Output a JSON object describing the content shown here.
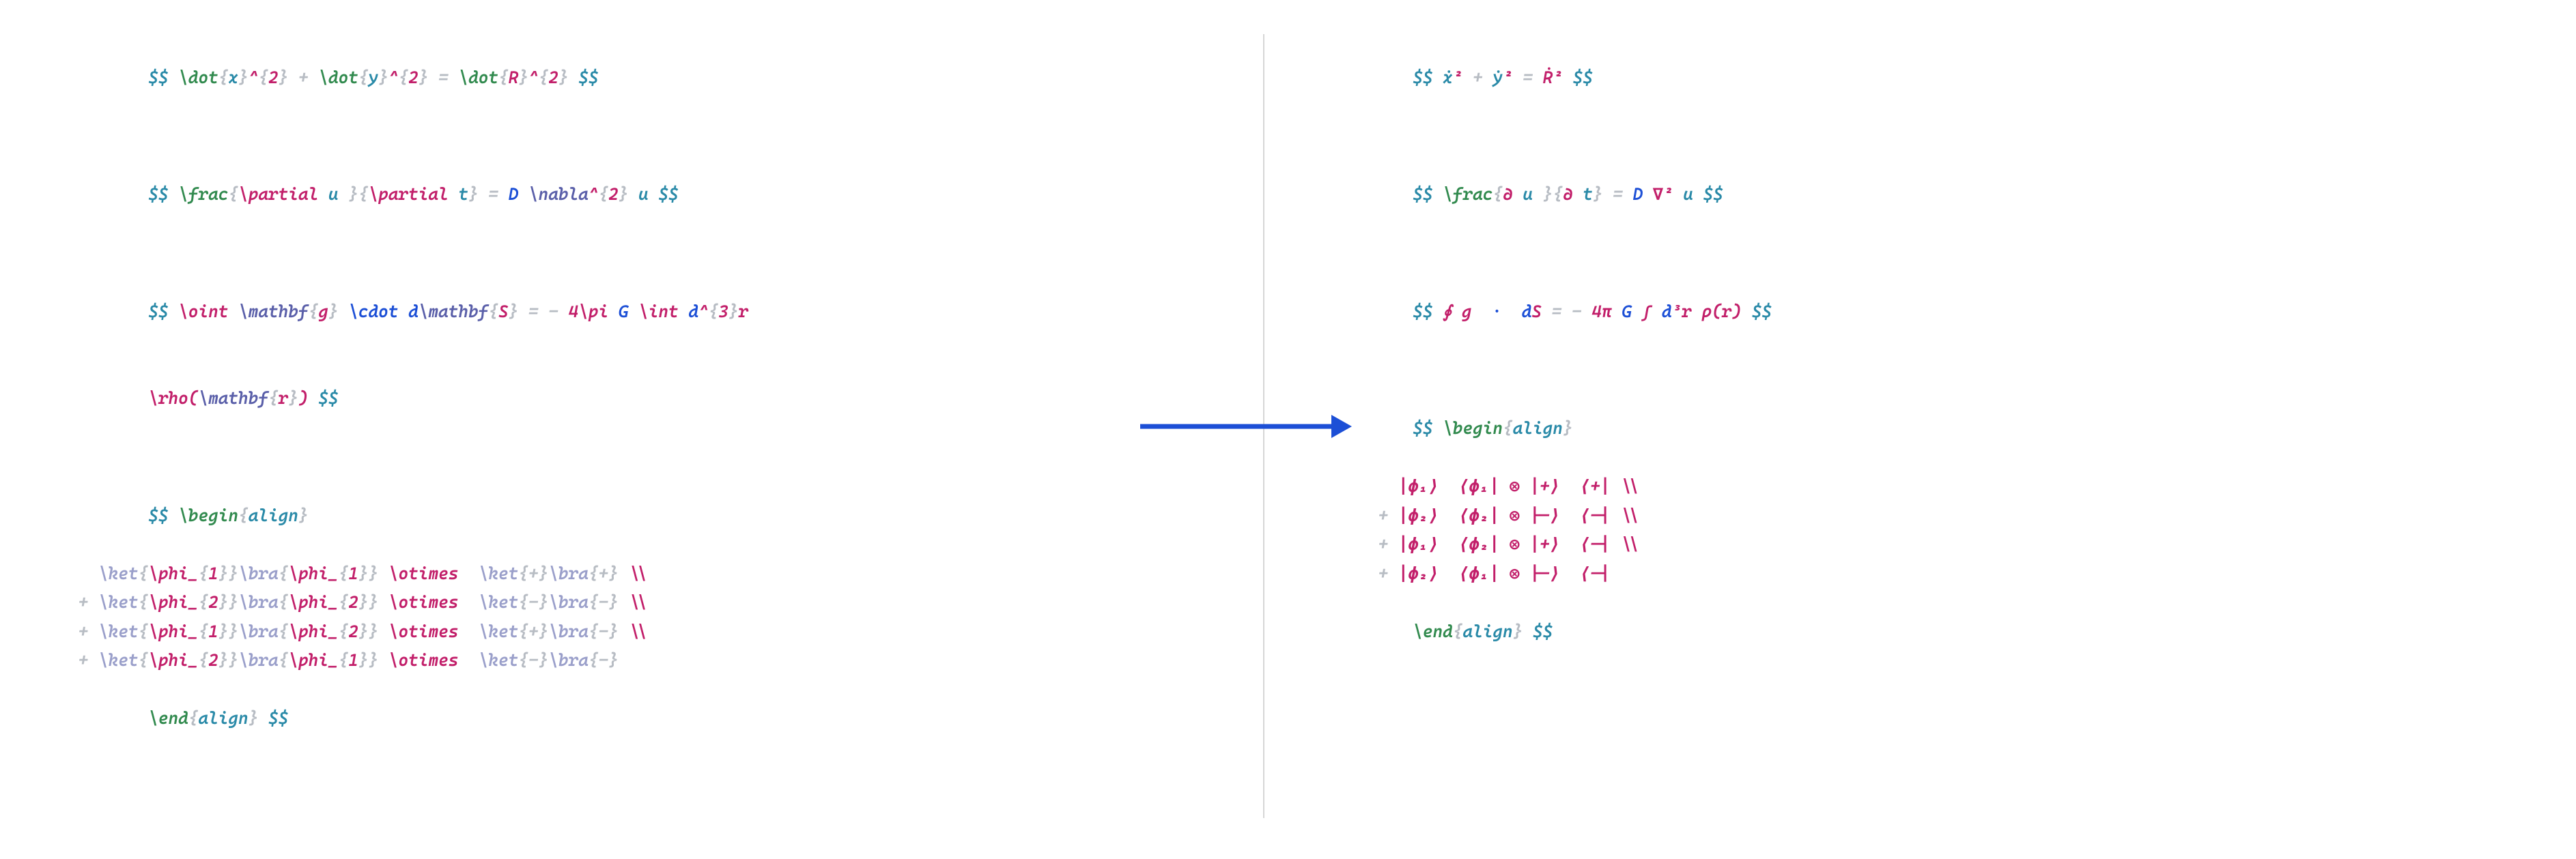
{
  "left": {
    "eq1": {
      "a": "$$ ",
      "b": "\\dot",
      "c": "{",
      "d": "x",
      "e": "}",
      "f": "^",
      "g": "{",
      "h": "2",
      "i": "}",
      "j": " + ",
      "k": "\\dot",
      "l": "{",
      "m": "y",
      "n": "}",
      "o": "^",
      "p": "{",
      "q": "2",
      "r": "}",
      "s": " = ",
      "t": "\\dot",
      "u": "{",
      "v": "R",
      "w": "}",
      "x": "^",
      "y": "{",
      "z": "2",
      "aa": "}",
      "ab": " $$"
    },
    "eq2": {
      "a": "$$ ",
      "b": "\\frac",
      "c": "{",
      "d": "\\partial",
      "e": " u ",
      "f": "}",
      "g": "{",
      "h": "\\partial",
      "i": " t",
      "j": "}",
      "k": " = ",
      "l": "D ",
      "m": "\\nabla",
      "n": "^",
      "o": "{",
      "p": "2",
      "q": "}",
      "r": " u ",
      "s": "$$"
    },
    "eq3l1": {
      "a": "$$ ",
      "b": "\\oint ",
      "c": "\\mathbf",
      "d": "{",
      "e": "g",
      "f": "}",
      "g": " \\cdot",
      "h": " d",
      "i": "\\mathbf",
      "j": "{",
      "k": "S",
      "l": "}",
      "m": " = - ",
      "n": "4",
      "o": "\\pi",
      "p": " G ",
      "q": "\\int ",
      "r": "d",
      "s": "^",
      "t": "{",
      "u": "3",
      "v": "}",
      "w": "r"
    },
    "eq3l2": {
      "a": "\\rho",
      "b": "(",
      "c": "\\mathbf",
      "d": "{",
      "e": "r",
      "f": "}",
      "g": ")",
      "h": " $$"
    },
    "eq4": {
      "open_a": "$$ ",
      "open_b": "\\begin",
      "open_c": "{",
      "open_d": "align",
      "open_e": "}",
      "r1": {
        "pre": "   ",
        "ket": "\\ket",
        "b1": "{",
        "phi": "\\phi",
        "us": "_",
        "b2": "{",
        "n": "1",
        "b3": "}",
        "b4": "}",
        "bra": "\\bra",
        "b5": "{",
        "phi2": "\\phi",
        "us2": "_",
        "b6": "{",
        "n2": "1",
        "b7": "}",
        "b8": "}",
        "ot": " \\otimes ",
        "ket2": " \\ket",
        "b9": "{",
        "sgn": "+",
        "b10": "}",
        "bra2": "\\bra",
        "b11": "{",
        "sgn2": "+",
        "b12": "}",
        "bs": " \\\\"
      },
      "r2": {
        "pre": " + ",
        "ket": "\\ket",
        "b1": "{",
        "phi": "\\phi",
        "us": "_",
        "b2": "{",
        "n": "2",
        "b3": "}",
        "b4": "}",
        "bra": "\\bra",
        "b5": "{",
        "phi2": "\\phi",
        "us2": "_",
        "b6": "{",
        "n2": "2",
        "b7": "}",
        "b8": "}",
        "ot": " \\otimes ",
        "ket2": " \\ket",
        "b9": "{",
        "sgn": "-",
        "b10": "}",
        "bra2": "\\bra",
        "b11": "{",
        "sgn2": "-",
        "b12": "}",
        "bs": " \\\\"
      },
      "r3": {
        "pre": " + ",
        "ket": "\\ket",
        "b1": "{",
        "phi": "\\phi",
        "us": "_",
        "b2": "{",
        "n": "1",
        "b3": "}",
        "b4": "}",
        "bra": "\\bra",
        "b5": "{",
        "phi2": "\\phi",
        "us2": "_",
        "b6": "{",
        "n2": "2",
        "b7": "}",
        "b8": "}",
        "ot": " \\otimes ",
        "ket2": " \\ket",
        "b9": "{",
        "sgn": "+",
        "b10": "}",
        "bra2": "\\bra",
        "b11": "{",
        "sgn2": "-",
        "b12": "}",
        "bs": " \\\\"
      },
      "r4": {
        "pre": " + ",
        "ket": "\\ket",
        "b1": "{",
        "phi": "\\phi",
        "us": "_",
        "b2": "{",
        "n": "2",
        "b3": "}",
        "b4": "}",
        "bra": "\\bra",
        "b5": "{",
        "phi2": "\\phi",
        "us2": "_",
        "b6": "{",
        "n2": "1",
        "b7": "}",
        "b8": "}",
        "ot": " \\otimes ",
        "ket2": " \\ket",
        "b9": "{",
        "sgn": "-",
        "b10": "}",
        "bra2": "\\bra",
        "b11": "{",
        "sgn2": "-",
        "b12": "}",
        "bs": ""
      },
      "close_a": "\\end",
      "close_b": "{",
      "close_c": "align",
      "close_d": "}",
      "close_e": " $$"
    }
  },
  "right": {
    "eq1": {
      "a": "$$ ",
      "b": "ẋ",
      "c": "²",
      "d": " + ",
      "e": "ẏ",
      "f": "²",
      "g": " = ",
      "h": "Ṙ",
      "i": "²",
      "j": " $$"
    },
    "eq2": {
      "a": "$$ ",
      "b": "\\frac",
      "c": "{",
      "d": "∂",
      "e": " u ",
      "f": "}",
      "g": "{",
      "h": "∂",
      "i": " t",
      "j": "}",
      "k": " = ",
      "l": "D ",
      "m": "∇",
      "n": "²",
      "o": " u ",
      "p": "$$"
    },
    "eq3": {
      "a": "$$ ",
      "b": "∮",
      "c": " g ",
      "d": " · ",
      "e": " d",
      "f": "S",
      "g": " = - ",
      "h": "4",
      "i": "π",
      "j": " G ",
      "k": "∫ ",
      "l": "d",
      "m": "³",
      "n": "r ",
      "o": "ρ",
      "p": "(",
      "q": "r",
      "r": ")",
      "s": " $$"
    },
    "eq4": {
      "open_a": "$$ ",
      "open_b": "\\begin",
      "open_c": "{",
      "open_d": "align",
      "open_e": "}",
      "r1": {
        "pre": "   ",
        "ket": "|ϕ₁⟩",
        "sp1": "  ",
        "bra": "⟨ϕ₁|",
        "sp2": " ",
        "ot": "⊗",
        "sp3": " ",
        "ket2": "|+⟩",
        "sp4": "  ",
        "bra2": "⟨+|",
        "bs": " \\\\"
      },
      "r2": {
        "pre": " + ",
        "ket": "|ϕ₂⟩",
        "sp1": "  ",
        "bra": "⟨ϕ₂|",
        "sp2": " ",
        "ot": "⊗",
        "sp3": " ",
        "ket2": "|-⟩",
        "sp4": "  ",
        "bra2": "⟨-|",
        "bs": " \\\\"
      },
      "r3": {
        "pre": " + ",
        "ket": "|ϕ₁⟩",
        "sp1": "  ",
        "bra": "⟨ϕ₂|",
        "sp2": " ",
        "ot": "⊗",
        "sp3": " ",
        "ket2": "|+⟩",
        "sp4": "  ",
        "bra2": "⟨-|",
        "bs": " \\\\"
      },
      "r4": {
        "pre": " + ",
        "ket": "|ϕ₂⟩",
        "sp1": "  ",
        "bra": "⟨ϕ₁|",
        "sp2": " ",
        "ot": "⊗",
        "sp3": " ",
        "ket2": "|-⟩",
        "sp4": "  ",
        "bra2": "⟨-|",
        "bs": ""
      },
      "close_a": "\\end",
      "close_b": "{",
      "close_c": "align",
      "close_d": "}",
      "close_e": " $$"
    }
  }
}
